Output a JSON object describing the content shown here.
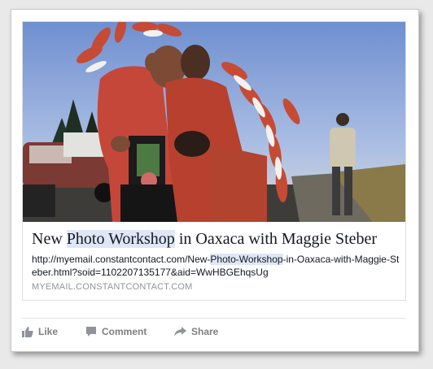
{
  "post": {
    "title_parts": [
      "New ",
      "Photo Workshop",
      " in Oaxaca with Maggie Steber"
    ],
    "url_parts": [
      "http://myemail.constantcontact.com/New-",
      "Photo-Workshop",
      "-in-Oaxaca-with-Maggie-Steber.html?soid=1102207135177&aid=WwHBGEhqsUg"
    ],
    "domain": "MYEMAIL.CONSTANTCONTACT.COM"
  },
  "actions": {
    "like": "Like",
    "comment": "Comment",
    "share": "Share"
  },
  "colors": {
    "highlight": "#dfe6f5",
    "action_text": "#7f7f7f",
    "domain_text": "#90949c"
  }
}
